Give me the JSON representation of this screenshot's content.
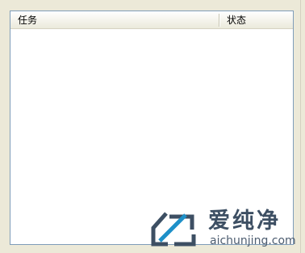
{
  "task_list": {
    "columns": [
      {
        "label": "任务"
      },
      {
        "label": "状态"
      }
    ],
    "rows": []
  },
  "watermark": {
    "brand": "爱纯净",
    "domain": "aichunjing.com",
    "accent_color": "#1e90c8"
  }
}
